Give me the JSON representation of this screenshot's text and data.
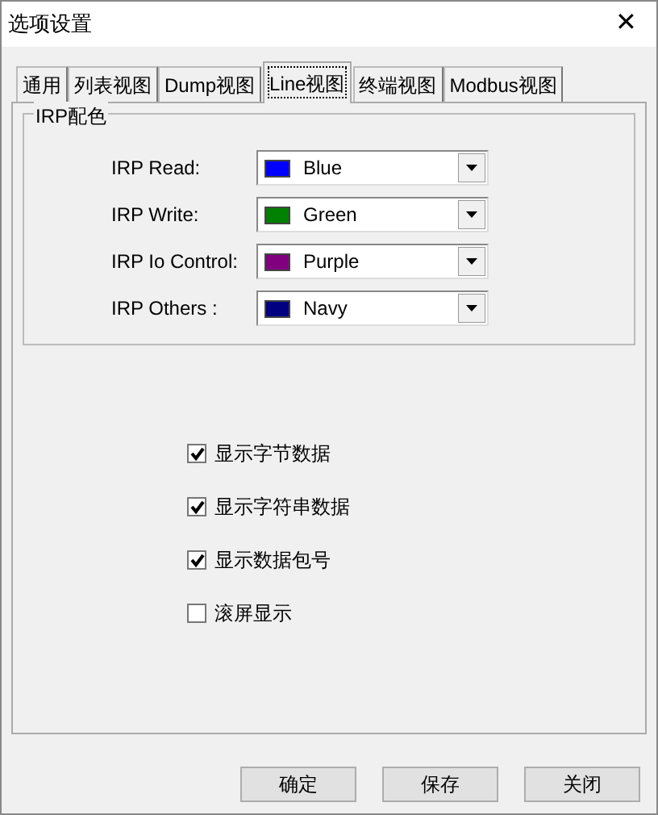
{
  "window": {
    "title": "选项设置",
    "close": "✕"
  },
  "tabs": [
    {
      "label": "通用",
      "selected": false
    },
    {
      "label": "列表视图",
      "selected": false
    },
    {
      "label": "Dump视图",
      "selected": false
    },
    {
      "label": "Line视图",
      "selected": true
    },
    {
      "label": "终端视图",
      "selected": false
    },
    {
      "label": "Modbus视图",
      "selected": false
    }
  ],
  "group": {
    "title": "IRP配色",
    "rows": [
      {
        "label": "IRP Read:",
        "value": "Blue",
        "color": "#0000ff"
      },
      {
        "label": "IRP Write:",
        "value": "Green",
        "color": "#008000"
      },
      {
        "label": "IRP Io Control:",
        "value": "Purple",
        "color": "#800080"
      },
      {
        "label": "IRP Others :",
        "value": "Navy",
        "color": "#000080"
      }
    ]
  },
  "options": [
    {
      "label": "显示字节数据",
      "checked": true
    },
    {
      "label": "显示字符串数据",
      "checked": true
    },
    {
      "label": "显示数据包号",
      "checked": true
    },
    {
      "label": "滚屏显示",
      "checked": false
    }
  ],
  "buttons": [
    "确定",
    "保存",
    "关闭"
  ]
}
